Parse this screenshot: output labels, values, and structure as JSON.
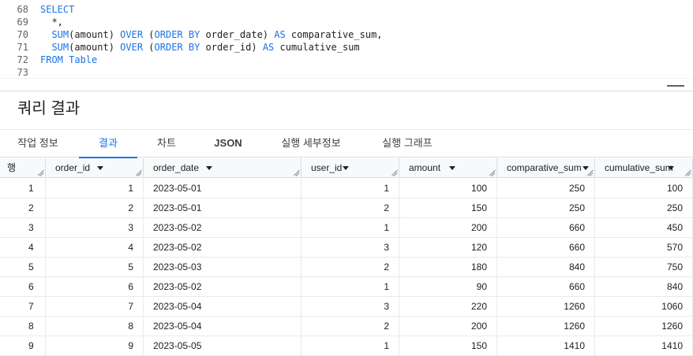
{
  "editor": {
    "lines": [
      {
        "number": "68",
        "segments": [
          {
            "t": "SELECT",
            "k": true
          }
        ]
      },
      {
        "number": "69",
        "segments": [
          {
            "t": "  *,",
            "k": false
          }
        ]
      },
      {
        "number": "70",
        "segments": [
          {
            "t": "  ",
            "k": false
          },
          {
            "t": "SUM",
            "k": true
          },
          {
            "t": "(amount) ",
            "k": false
          },
          {
            "t": "OVER",
            "k": true
          },
          {
            "t": " (",
            "k": false
          },
          {
            "t": "ORDER BY",
            "k": true
          },
          {
            "t": " order_date) ",
            "k": false
          },
          {
            "t": "AS",
            "k": true
          },
          {
            "t": " comparative_sum,",
            "k": false
          }
        ]
      },
      {
        "number": "71",
        "segments": [
          {
            "t": "  ",
            "k": false
          },
          {
            "t": "SUM",
            "k": true
          },
          {
            "t": "(amount) ",
            "k": false
          },
          {
            "t": "OVER",
            "k": true
          },
          {
            "t": " (",
            "k": false
          },
          {
            "t": "ORDER BY",
            "k": true
          },
          {
            "t": " order_id) ",
            "k": false
          },
          {
            "t": "AS",
            "k": true
          },
          {
            "t": " cumulative_sum",
            "k": false
          }
        ]
      },
      {
        "number": "72",
        "segments": [
          {
            "t": "FROM Table",
            "k": true
          }
        ]
      },
      {
        "number": "73",
        "segments": []
      }
    ]
  },
  "results": {
    "title": "쿼리 결과"
  },
  "tabs": [
    {
      "label": "작업 정보",
      "name": "tab-job-info",
      "bold": false,
      "active": false
    },
    {
      "label": "결과",
      "name": "tab-results",
      "bold": false,
      "active": true
    },
    {
      "label": "차트",
      "name": "tab-chart",
      "bold": false,
      "active": false
    },
    {
      "label": "JSON",
      "name": "tab-json",
      "bold": true,
      "active": false
    },
    {
      "label": "실행 세부정보",
      "name": "tab-execution-details",
      "bold": false,
      "active": false
    },
    {
      "label": "실행 그래프",
      "name": "tab-execution-graph",
      "bold": false,
      "active": false
    }
  ],
  "table": {
    "row_header": "행",
    "columns": [
      "order_id",
      "order_date",
      "user_id",
      "amount",
      "comparative_sum",
      "cumulative_sum"
    ],
    "rows": [
      [
        "1",
        "1",
        "2023-05-01",
        "1",
        "100",
        "250",
        "100"
      ],
      [
        "2",
        "2",
        "2023-05-01",
        "2",
        "150",
        "250",
        "250"
      ],
      [
        "3",
        "3",
        "2023-05-02",
        "1",
        "200",
        "660",
        "450"
      ],
      [
        "4",
        "4",
        "2023-05-02",
        "3",
        "120",
        "660",
        "570"
      ],
      [
        "5",
        "5",
        "2023-05-03",
        "2",
        "180",
        "840",
        "750"
      ],
      [
        "6",
        "6",
        "2023-05-02",
        "1",
        "90",
        "660",
        "840"
      ],
      [
        "7",
        "7",
        "2023-05-04",
        "3",
        "220",
        "1260",
        "1060"
      ],
      [
        "8",
        "8",
        "2023-05-04",
        "2",
        "200",
        "1260",
        "1260"
      ],
      [
        "9",
        "9",
        "2023-05-05",
        "1",
        "150",
        "1410",
        "1410"
      ]
    ]
  },
  "colors": {
    "keyword": "#1a73e8",
    "active_tab": "#1a73e8",
    "header_bg": "#f8f9fa"
  }
}
